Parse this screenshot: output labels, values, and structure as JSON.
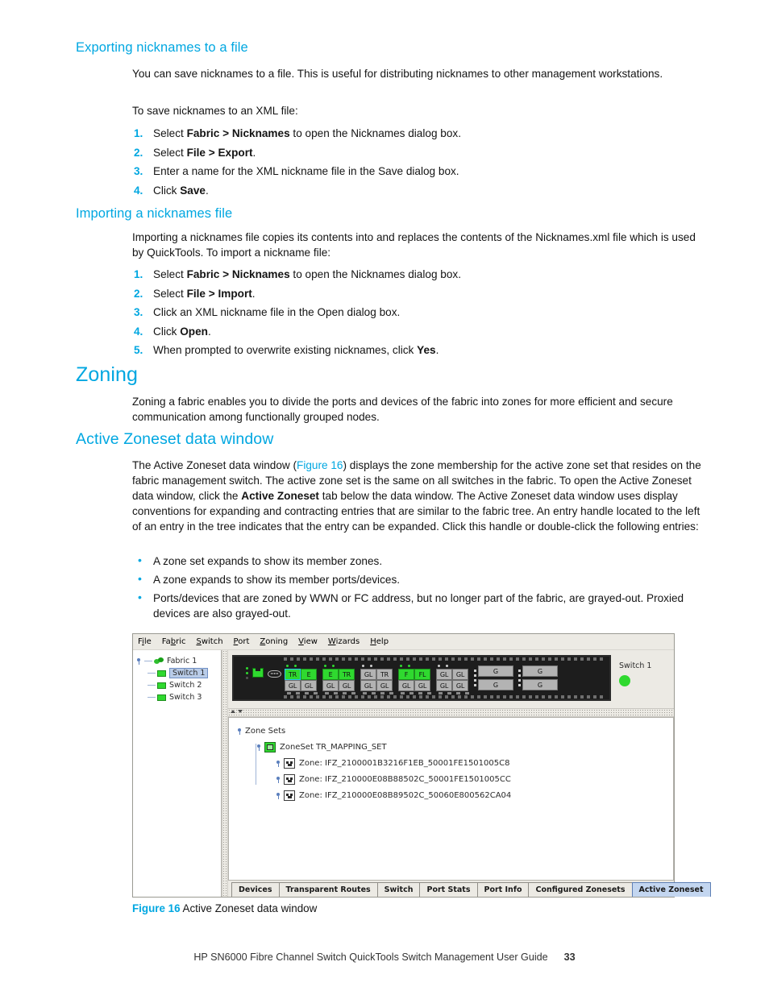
{
  "sections": {
    "exporting": {
      "heading": "Exporting nicknames to a file",
      "intro": "You can save nicknames to a file. This is useful for distributing nicknames to other management workstations.",
      "lead": "To save nicknames to an XML file:",
      "steps": [
        {
          "num": "1.",
          "pre": "Select ",
          "bold": "Fabric > Nicknames",
          "post": " to open the Nicknames dialog box."
        },
        {
          "num": "2.",
          "pre": "Select ",
          "bold": "File > Export",
          "post": "."
        },
        {
          "num": "3.",
          "pre": "Enter a name for the XML nickname file in the Save dialog box.",
          "bold": "",
          "post": ""
        },
        {
          "num": "4.",
          "pre": "Click ",
          "bold": "Save",
          "post": "."
        }
      ]
    },
    "importing": {
      "heading": "Importing a nicknames file",
      "intro": "Importing a nicknames file copies its contents into and replaces the contents of the Nicknames.xml file which is used by QuickTools. To import a nickname file:",
      "steps": [
        {
          "num": "1.",
          "pre": "Select ",
          "bold": "Fabric > Nicknames",
          "post": " to open the Nicknames dialog box."
        },
        {
          "num": "2.",
          "pre": "Select ",
          "bold": "File > Import",
          "post": "."
        },
        {
          "num": "3.",
          "pre": "Click an XML nickname file in the Open dialog box.",
          "bold": "",
          "post": ""
        },
        {
          "num": "4.",
          "pre": "Click ",
          "bold": "Open",
          "post": "."
        },
        {
          "num": "5.",
          "pre": "When prompted to overwrite existing nicknames, click ",
          "bold": "Yes",
          "post": "."
        }
      ]
    },
    "zoning": {
      "heading": "Zoning",
      "intro": "Zoning a fabric enables you to divide the ports and devices of the fabric into zones for more efficient and secure communication among functionally grouped nodes."
    },
    "active_zoneset": {
      "heading": "Active Zoneset data window",
      "para_1": "The Active Zoneset data window (",
      "para_link": "Figure 16",
      "para_2": ") displays the zone membership for the active zone set that resides on the fabric management switch. The active zone set is the same on all switches in the fabric. To open the Active Zoneset data window, click the ",
      "para_bold": "Active Zoneset",
      "para_3": " tab below the data window. The Active Zoneset data window uses display conventions for expanding and contracting entries that are similar to the fabric tree. An entry handle located to the left of an entry in the tree indicates that the entry can be expanded. Click this handle or double-click the following entries:",
      "bullets": [
        "A zone set expands to show its member zones.",
        "A zone expands to show its member ports/devices.",
        "Ports/devices that are zoned by WWN or FC address, but no longer part of the fabric, are grayed-out. Proxied devices are also grayed-out."
      ]
    }
  },
  "figure": {
    "number": "Figure 16",
    "caption": "Active Zoneset data window"
  },
  "footer": {
    "text": "HP SN6000 Fibre Channel Switch QuickTools Switch Management User Guide",
    "page": "33"
  },
  "app": {
    "menu": [
      {
        "pre": "F",
        "u": "i",
        "post": "le"
      },
      {
        "pre": "Fa",
        "u": "b",
        "post": "ric"
      },
      {
        "pre": "",
        "u": "S",
        "post": "witch"
      },
      {
        "pre": "",
        "u": "P",
        "post": "ort"
      },
      {
        "pre": "",
        "u": "Z",
        "post": "oning"
      },
      {
        "pre": "",
        "u": "V",
        "post": "iew"
      },
      {
        "pre": "",
        "u": "W",
        "post": "izards"
      },
      {
        "pre": "",
        "u": "H",
        "post": "elp"
      }
    ],
    "fabric_tree": {
      "root": "Fabric 1",
      "switches": [
        "Switch 1",
        "Switch 2",
        "Switch 3"
      ],
      "selected": "Switch 1"
    },
    "switch_panel": {
      "label": "Switch 1",
      "status_color": "#2fd92f",
      "port_groups": [
        {
          "top": [
            "TR",
            "E"
          ],
          "bottom": [
            "GL",
            "GL"
          ],
          "top_state": [
            "green-selected",
            "green"
          ],
          "bottom_state": [
            "gray",
            "gray"
          ],
          "leds": [
            "on",
            "on"
          ]
        },
        {
          "top": [
            "E",
            "TR"
          ],
          "bottom": [
            "GL",
            "GL"
          ],
          "top_state": [
            "green",
            "green"
          ],
          "bottom_state": [
            "gray",
            "gray"
          ],
          "leds": [
            "on",
            "on"
          ]
        },
        {
          "top": [
            "GL",
            "TR"
          ],
          "bottom": [
            "GL",
            "GL"
          ],
          "top_state": [
            "gray",
            "gray"
          ],
          "bottom_state": [
            "gray",
            "gray"
          ],
          "leds": [
            "off",
            "off"
          ]
        },
        {
          "top": [
            "F",
            "FL"
          ],
          "bottom": [
            "GL",
            "GL"
          ],
          "top_state": [
            "green",
            "green"
          ],
          "bottom_state": [
            "gray",
            "gray"
          ],
          "leds": [
            "on",
            "on"
          ]
        },
        {
          "top": [
            "GL",
            "GL"
          ],
          "bottom": [
            "GL",
            "GL"
          ],
          "top_state": [
            "gray",
            "gray"
          ],
          "bottom_state": [
            "gray",
            "gray"
          ],
          "leds": [
            "off",
            "off"
          ]
        }
      ],
      "g_ports": [
        [
          "G",
          "G"
        ],
        [
          "G",
          "G"
        ]
      ]
    },
    "zoneset_tree": {
      "root": "Zone Sets",
      "zoneset": "ZoneSet TR_MAPPING_SET",
      "zones": [
        "Zone: IFZ_2100001B3216F1EB_50001FE1501005C8",
        "Zone: IFZ_210000E08B88502C_50001FE1501005CC",
        "Zone: IFZ_210000E08B89502C_50060E800562CA04"
      ]
    },
    "tabs": [
      {
        "label": "Devices",
        "active": false
      },
      {
        "label": "Transparent Routes",
        "active": false
      },
      {
        "label": "Switch",
        "active": false
      },
      {
        "label": "Port Stats",
        "active": false
      },
      {
        "label": "Port Info",
        "active": false
      },
      {
        "label": "Configured Zonesets",
        "active": false
      },
      {
        "label": "Active Zoneset",
        "active": true
      }
    ]
  },
  "colors": {
    "accent_blue": "#00a7e1",
    "led_green": "#2fd92f",
    "tab_active": "#c3d6f0"
  }
}
